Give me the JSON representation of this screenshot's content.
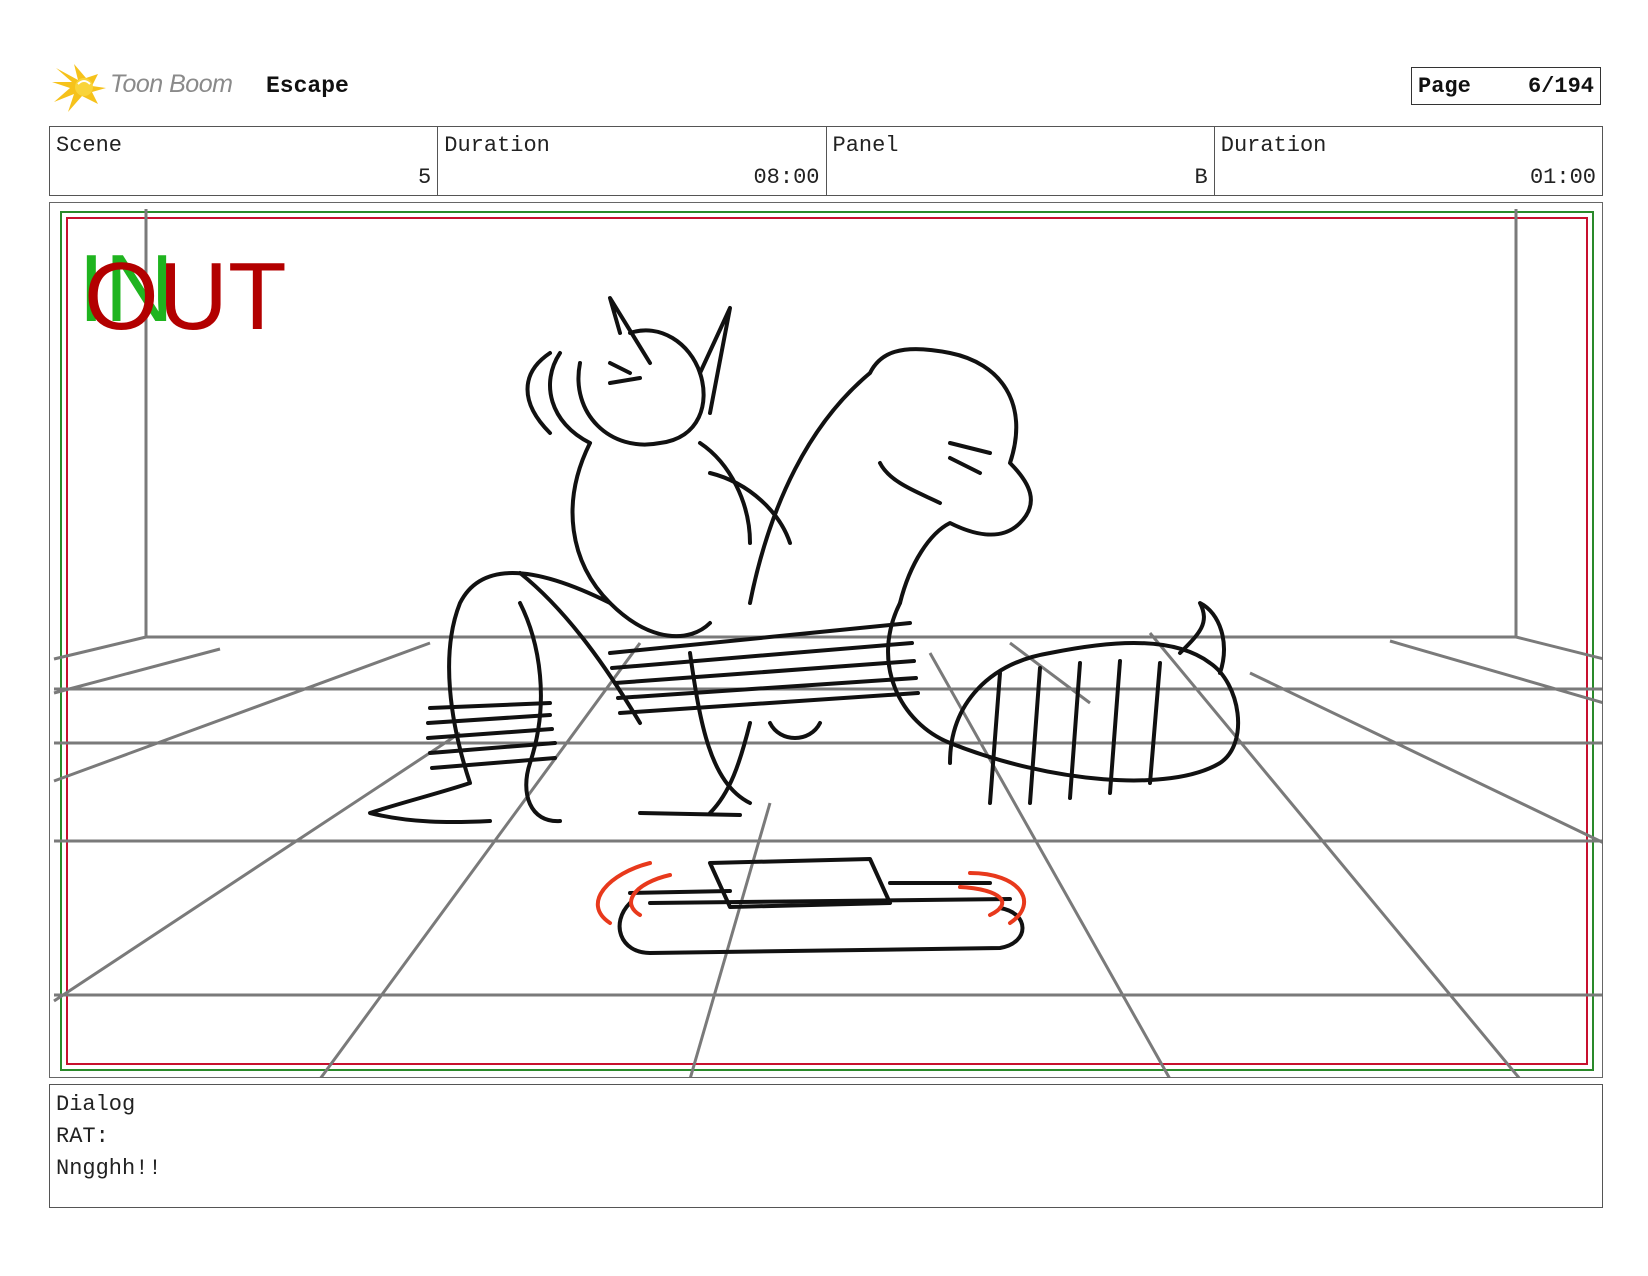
{
  "header": {
    "brand": "Toon Boom",
    "project": "Escape",
    "page_label": "Page",
    "page_value": "6/194"
  },
  "info": {
    "scene_label": "Scene",
    "scene_value": "5",
    "scene_duration_label": "Duration",
    "scene_duration_value": "08:00",
    "panel_label": "Panel",
    "panel_value": "B",
    "panel_duration_label": "Duration",
    "panel_duration_value": "01:00"
  },
  "panel": {
    "in_marker": "IN",
    "out_marker": "OUT",
    "in_color": "#1fb41f",
    "out_color": "#b30000",
    "safe_frame_color": "#c8102e",
    "action_frame_color": "#2a8a2a",
    "icon": "sketch-rat-and-snake-tied-icon"
  },
  "dialog": {
    "label": "Dialog",
    "speaker": "RAT:",
    "line": "Nngghh!!"
  },
  "colors": {
    "brand_star": "#f6c21b",
    "grid_lines": "#7a7a7a",
    "motion_lines": "#e8391c"
  }
}
